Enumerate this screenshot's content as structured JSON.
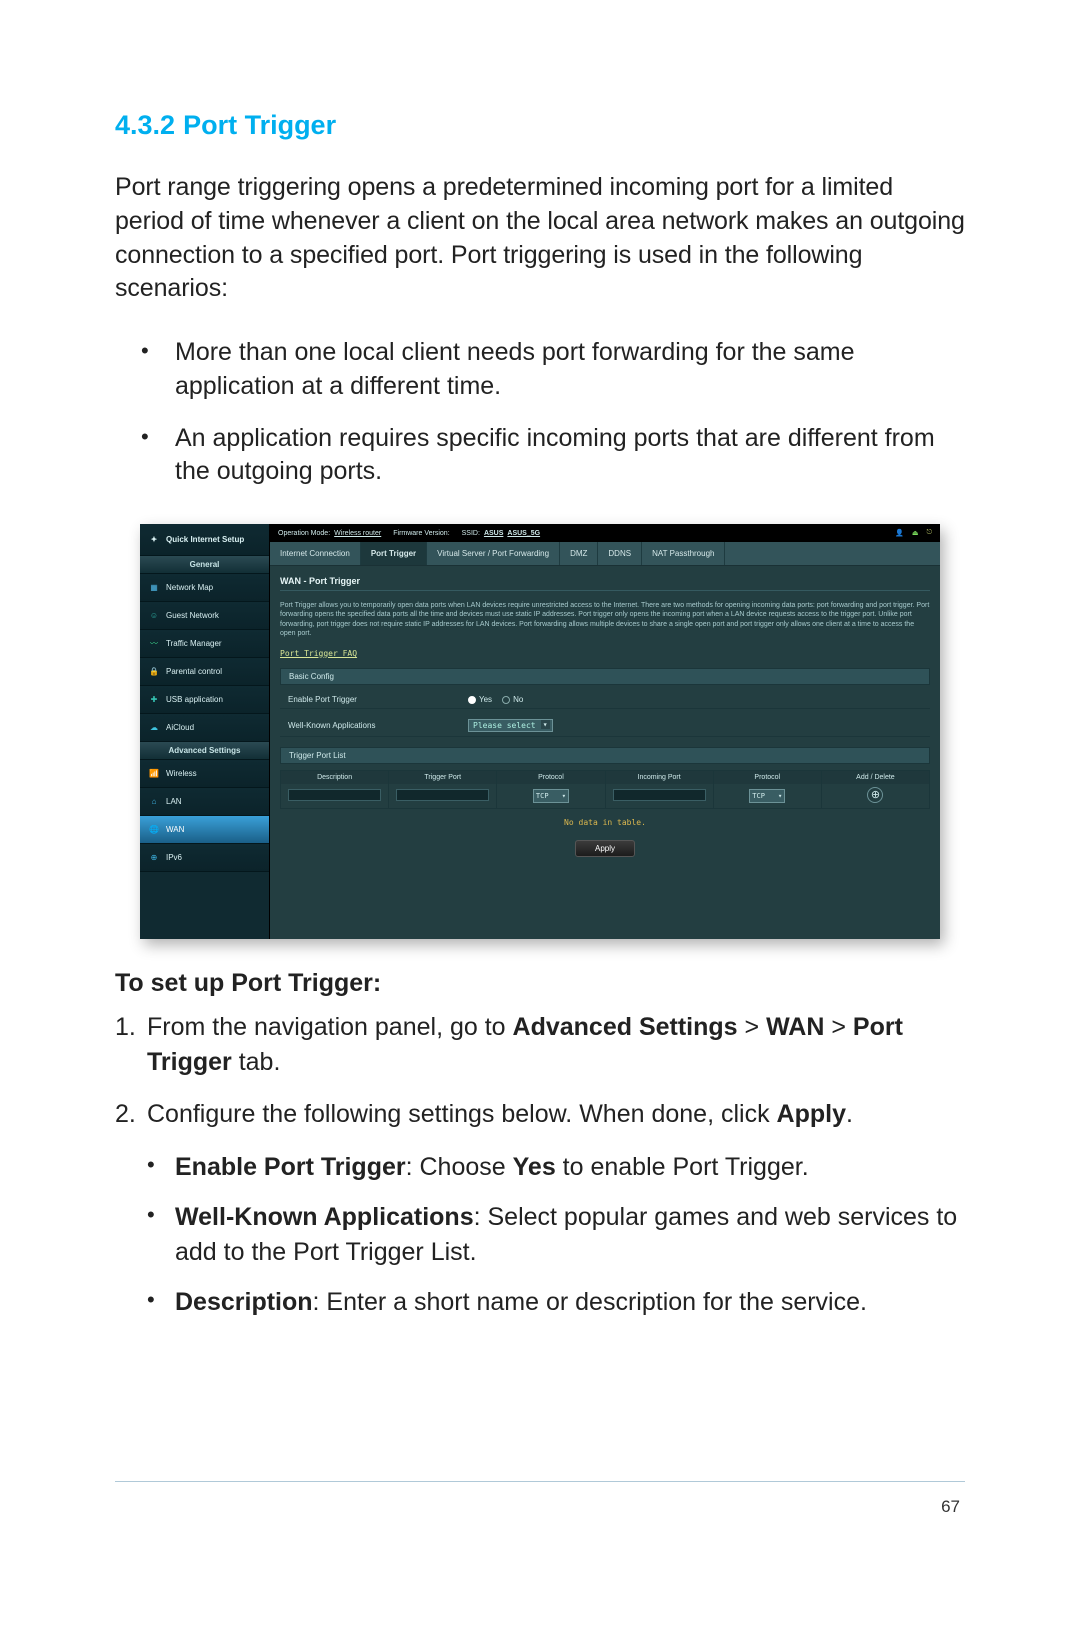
{
  "page_number": "67",
  "heading": {
    "num": "4.3.2",
    "title": "Port Trigger"
  },
  "intro": "Port range triggering opens a predetermined incoming port for a limited period of time whenever a client on the local area network makes an outgoing connection to a specified port. Port triggering is used in the following scenarios:",
  "scenario_bullets": [
    "More than one local client needs port forwarding for the same application at a different time.",
    "An application requires specific incoming ports that are different from the outgoing ports."
  ],
  "setup_heading": "To set up Port Trigger:",
  "step1_pre": "From the navigation panel, go to ",
  "step1_bold1": "Advanced Settings",
  "step1_gt1": " > ",
  "step1_bold2": "WAN",
  "step1_gt2": " > ",
  "step1_bold3": "Port Trigger",
  "step1_post": " tab.",
  "step2_pre": "Configure the following settings below. When done, click ",
  "step2_bold": "Apply",
  "step2_post": ".",
  "sub_bullets": [
    {
      "bold": "Enable Port Trigger",
      "rest": ": Choose ",
      "bold2": "Yes",
      "rest2": " to enable Port Trigger."
    },
    {
      "bold": "Well-Known Applications",
      "rest": ": Select popular games and web services to add to the Port Trigger List."
    },
    {
      "bold": "Description",
      "rest": ": Enter a short name or description for the service."
    }
  ],
  "router": {
    "sidebar": {
      "quick_setup": "Quick Internet Setup",
      "general": "General",
      "adv": "Advanced Settings",
      "items_general": [
        {
          "icon": "network-map-icon",
          "label": "Network Map"
        },
        {
          "icon": "guest-network-icon",
          "label": "Guest Network"
        },
        {
          "icon": "traffic-manager-icon",
          "label": "Traffic Manager"
        },
        {
          "icon": "parental-control-icon",
          "label": "Parental control"
        },
        {
          "icon": "usb-application-icon",
          "label": "USB application"
        },
        {
          "icon": "aicloud-icon",
          "label": "AiCloud"
        }
      ],
      "items_adv": [
        {
          "icon": "wireless-icon",
          "label": "Wireless"
        },
        {
          "icon": "lan-icon",
          "label": "LAN"
        },
        {
          "icon": "wan-icon",
          "label": "WAN"
        },
        {
          "icon": "ipv6-icon",
          "label": "IPv6"
        }
      ]
    },
    "topbar": {
      "opmode_label": "Operation Mode:",
      "opmode_value": "Wireless router",
      "fw_label": "Firmware Version:",
      "ssid_label": "SSID:",
      "ssid1": "ASUS",
      "ssid2": "ASUS_5G"
    },
    "tabs": [
      "Internet Connection",
      "Port Trigger",
      "Virtual Server / Port Forwarding",
      "DMZ",
      "DDNS",
      "NAT Passthrough"
    ],
    "panel": {
      "title": "WAN - Port Trigger",
      "desc": "Port Trigger allows you to temporarily open data ports when LAN devices require unrestricted access to the Internet. There are two methods for opening incoming data ports: port forwarding and port trigger. Port forwarding opens the specified data ports all the time and devices must use static IP addresses. Port trigger only opens the incoming port when a LAN device requests access to the trigger port. Unlike port forwarding, port trigger does not require static IP addresses for LAN devices. Port forwarding allows multiple devices to share a single open port and port trigger only allows one client at a time to access the open port.",
      "faq": "Port Trigger FAQ",
      "basic_config": "Basic Config",
      "enable_label": "Enable Port Trigger",
      "yes": "Yes",
      "no": "No",
      "wellknown_label": "Well-Known Applications",
      "wellknown_value": "Please select",
      "list_head": "Trigger Port List",
      "cols": [
        "Description",
        "Trigger Port",
        "Protocol",
        "Incoming Port",
        "Protocol",
        "Add / Delete"
      ],
      "tcp": "TCP",
      "nodata": "No data in table.",
      "apply": "Apply"
    }
  }
}
